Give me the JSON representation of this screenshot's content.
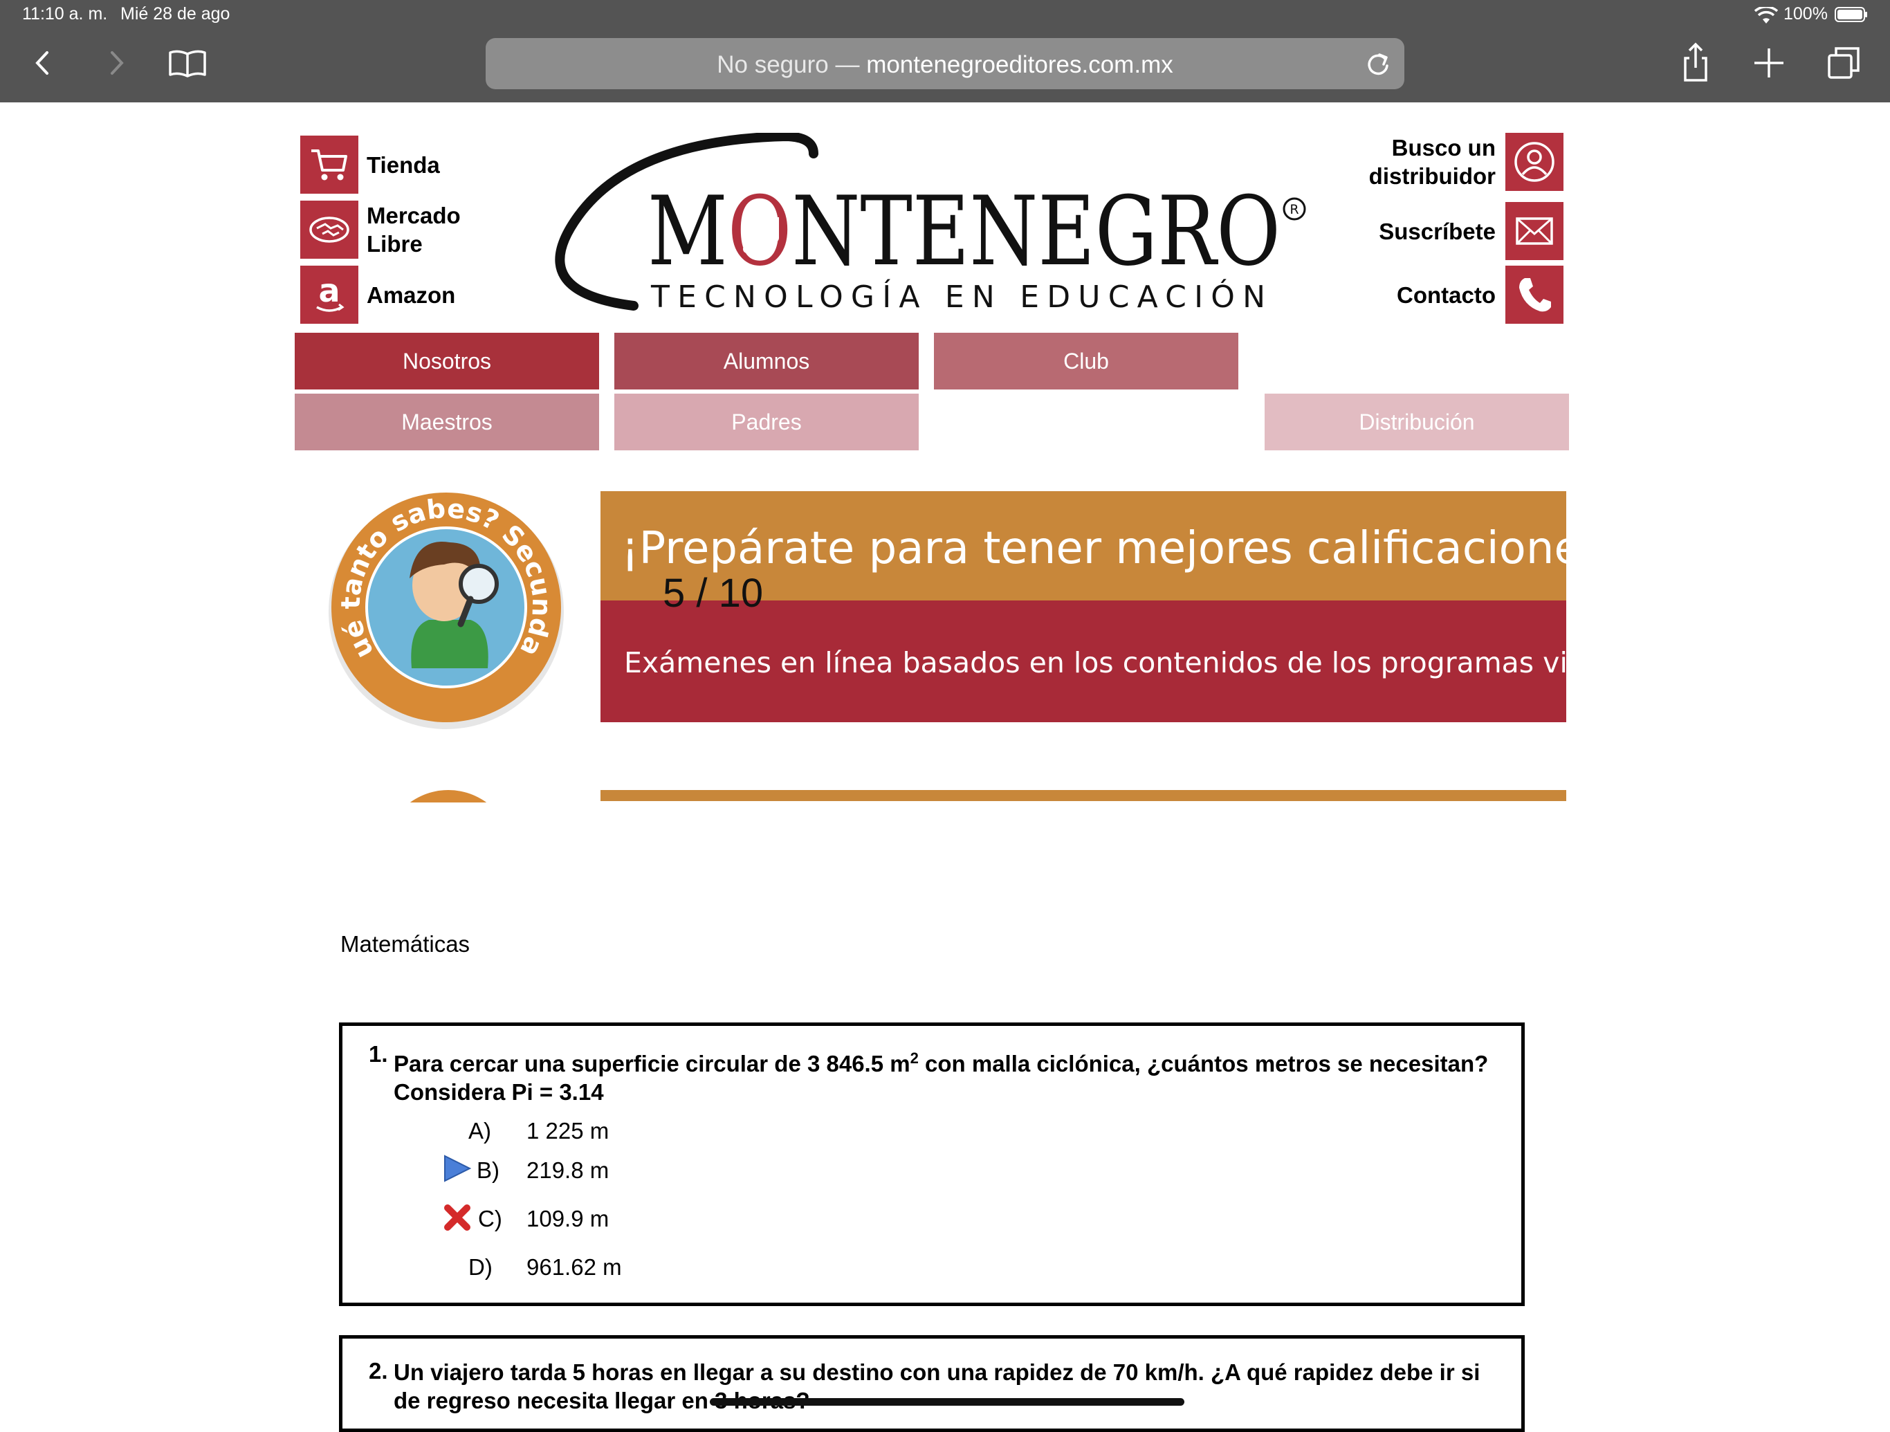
{
  "status_bar": {
    "time": "11:10 a. m.",
    "date": "Mié 28 de ago",
    "battery": "100%"
  },
  "browser": {
    "url_prefix": "No seguro — ",
    "url_host": "montenegroeditores.com.mx"
  },
  "left_links": [
    {
      "label": "Tienda",
      "icon": "cart-icon"
    },
    {
      "label": "Mercado Libre",
      "icon": "handshake-icon"
    },
    {
      "label": "Amazon",
      "icon": "amazon-icon"
    }
  ],
  "right_links": [
    {
      "label": "Busco un distribuidor",
      "icon": "person-icon"
    },
    {
      "label": "Suscríbete",
      "icon": "mail-icon"
    },
    {
      "label": "Contacto",
      "icon": "phone-icon"
    }
  ],
  "logo": {
    "name": "MONTENEGRO",
    "tagline": "TECNOLOGÍA EN EDUCACIÓN"
  },
  "menu": {
    "nosotros": "Nosotros",
    "alumnos": "Alumnos",
    "club": "Club",
    "maestros": "Maestros",
    "padres": "Padres",
    "distribucion": "Distribución"
  },
  "banner": {
    "badge_text": "¿Qué tanto sabes? Secundaria",
    "title": "¡Prepárate para tener mejores calificacione",
    "subtitle": "Exámenes en línea basados en los contenidos de los programas vig",
    "counter": "5 / 10"
  },
  "subject": "Matemáticas",
  "questions": [
    {
      "number": "1.",
      "text_before": "Para cercar una superficie circular de 3 846.5 m",
      "sup": "2",
      "text_after": " con malla ciclónica, ¿cuántos metros se necesitan? Considera Pi = 3.14",
      "options": [
        {
          "letter": "A)",
          "text": "1 225 m",
          "marker": "none"
        },
        {
          "letter": "B)",
          "text": "219.8 m",
          "marker": "play-arrow-icon"
        },
        {
          "letter": "C)",
          "text": "109.9 m",
          "marker": "red-x-icon"
        },
        {
          "letter": "D)",
          "text": "961.62 m",
          "marker": "none"
        }
      ]
    },
    {
      "number": "2.",
      "text": "Un viajero tarda 5 horas en llegar a su destino con una rapidez de 70 km/h. ¿A qué rapidez debe ir si de regreso necesita llegar en 3 horas?"
    }
  ],
  "colors": {
    "chrome": "#545454",
    "brand_red": "#b3313e",
    "banner_orange": "#c8873a",
    "banner_red": "#a82a38",
    "menu_1": "#a8313b",
    "menu_2": "#a84a55",
    "menu_3": "#b86a72",
    "menu_4": "#c48a92",
    "menu_5": "#d8a8b0",
    "menu_6": "#e2bcc2"
  }
}
